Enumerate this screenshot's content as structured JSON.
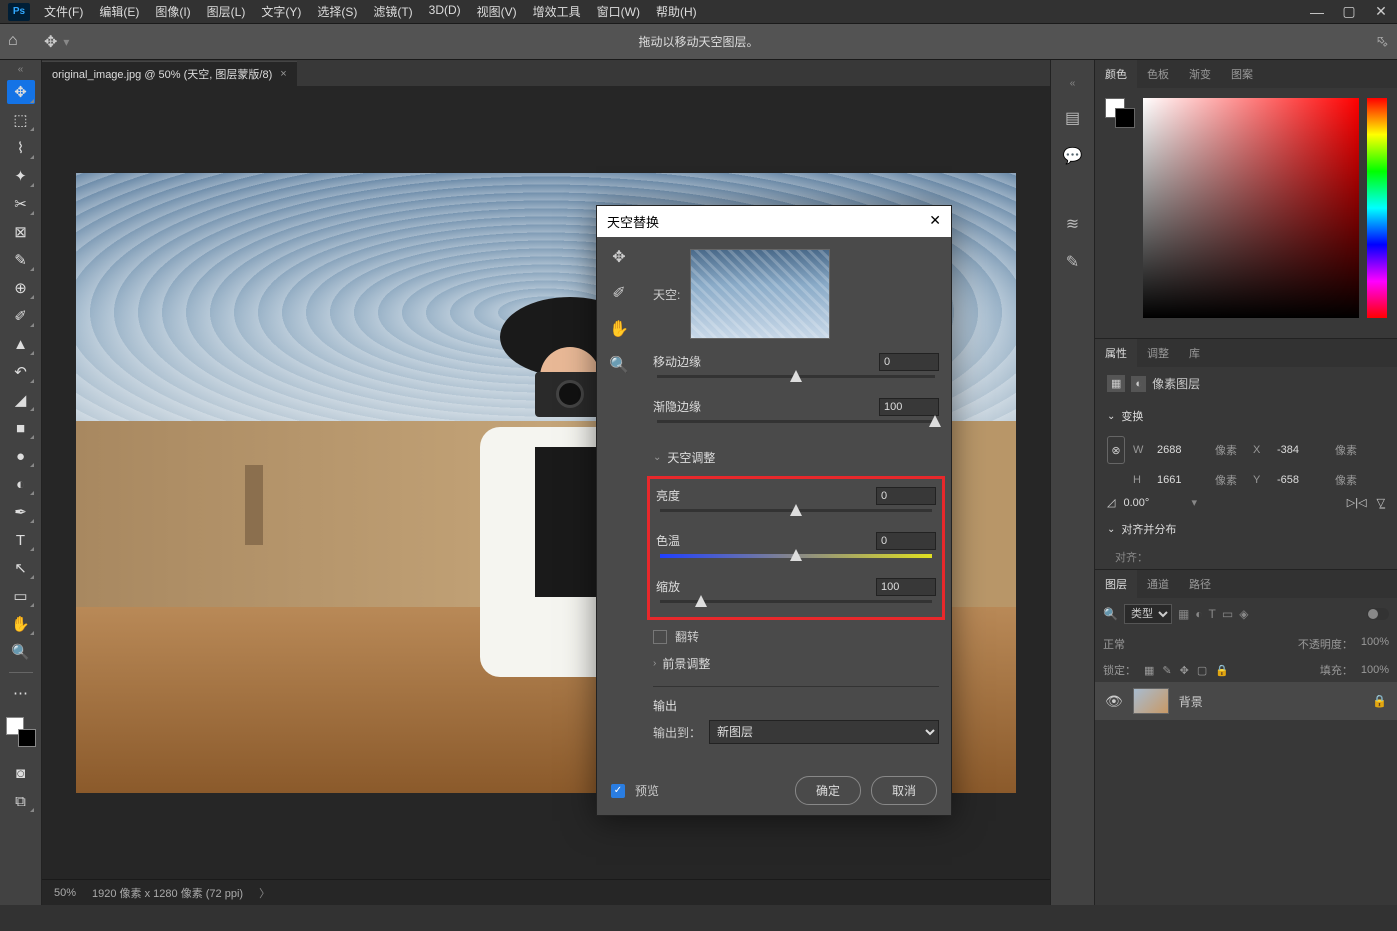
{
  "menu": [
    "文件(F)",
    "编辑(E)",
    "图像(I)",
    "图层(L)",
    "文字(Y)",
    "选择(S)",
    "滤镜(T)",
    "3D(D)",
    "视图(V)",
    "增效工具",
    "窗口(W)",
    "帮助(H)"
  ],
  "optbar_msg": "拖动以移动天空图层。",
  "doc_tab": "original_image.jpg @ 50% (天空, 图层蒙版/8)",
  "status": {
    "zoom": "50%",
    "dims": "1920 像素 x 1280 像素 (72 ppi)"
  },
  "panels": {
    "color_tabs": [
      "颜色",
      "色板",
      "渐变",
      "图案"
    ],
    "props_tabs": [
      "属性",
      "调整",
      "库"
    ],
    "props_type": "像素图层",
    "transform": "变换",
    "W": "2688",
    "H": "1661",
    "X": "-384",
    "Y": "-658",
    "unit": "像素",
    "angle": "0.00°",
    "align": "对齐并分布",
    "align_sub": "对齐：",
    "layer_tabs": [
      "图层",
      "通道",
      "路径"
    ],
    "layer_type": "类型",
    "blend": "正常",
    "opacity_lbl": "不透明度：",
    "opacity": "100%",
    "lock_lbl": "锁定：",
    "fill_lbl": "填充：",
    "fill": "100%",
    "layer_name": "背景"
  },
  "dialog": {
    "title": "天空替换",
    "sky_lbl": "天空:",
    "move_edge": "移动边缘",
    "move_edge_val": "0",
    "fade_edge": "渐隐边缘",
    "fade_edge_val": "100",
    "sky_adjust": "天空调整",
    "brightness": "亮度",
    "brightness_val": "0",
    "temp": "色温",
    "temp_val": "0",
    "scale": "缩放",
    "scale_val": "100",
    "flip": "翻转",
    "fg_adjust": "前景调整",
    "output": "输出",
    "output_to": "输出到：",
    "output_sel": "新图层",
    "preview": "预览",
    "ok": "确定",
    "cancel": "取消"
  }
}
